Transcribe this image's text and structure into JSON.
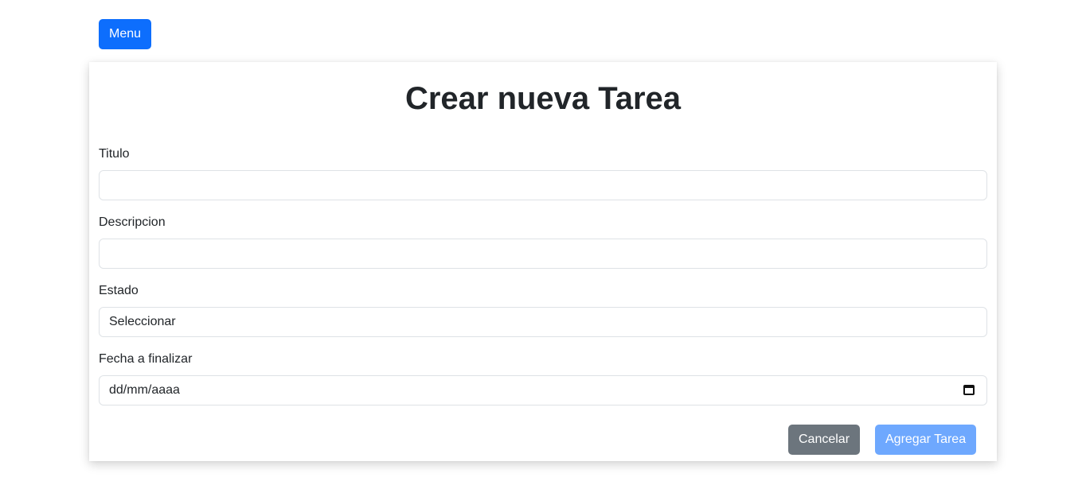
{
  "menu_button": "Menu",
  "form": {
    "title": "Crear nueva Tarea",
    "fields": {
      "titulo": {
        "label": "Titulo",
        "value": ""
      },
      "descripcion": {
        "label": "Descripcion",
        "value": ""
      },
      "estado": {
        "label": "Estado",
        "selected": "Seleccionar"
      },
      "fecha": {
        "label": "Fecha a finalizar",
        "placeholder": "dd/mm/aaaa"
      }
    },
    "buttons": {
      "cancel": "Cancelar",
      "submit": "Agregar Tarea"
    }
  },
  "colors": {
    "primary": "#0d6efd",
    "primary_disabled": "#6ea8fe",
    "secondary": "#6c757d",
    "border": "#dee2e6"
  },
  "icons": {
    "date_picker": "calendar-icon"
  }
}
